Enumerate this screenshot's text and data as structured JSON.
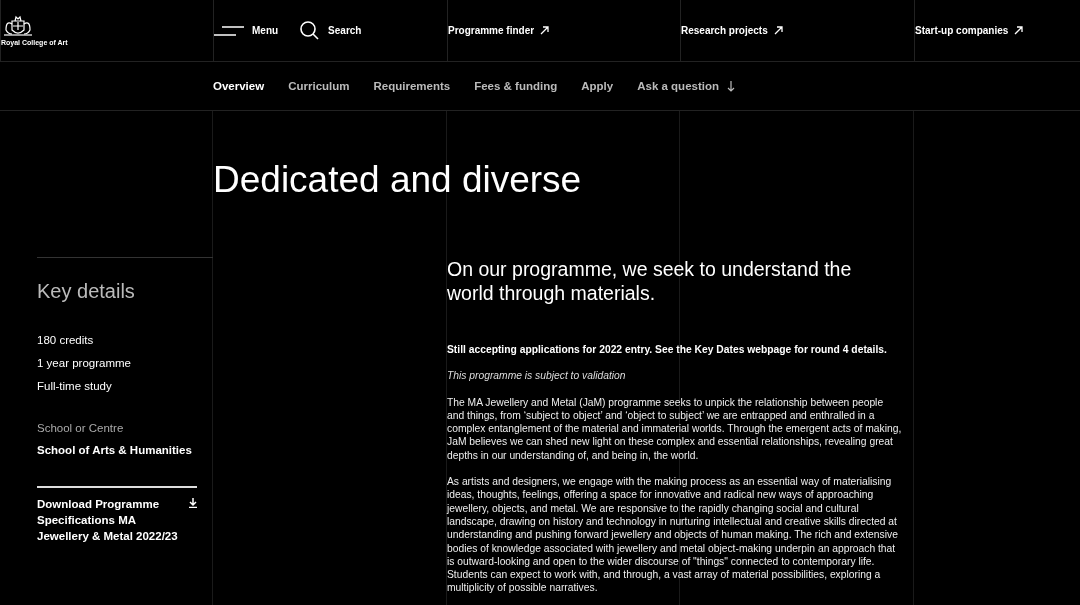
{
  "header": {
    "logo_text": "Royal College of Art",
    "menu_label": "Menu",
    "search_label": "Search",
    "links": [
      {
        "label": "Programme finder",
        "kind": "external"
      },
      {
        "label": "Research projects",
        "kind": "external"
      },
      {
        "label": "Start-up companies",
        "kind": "external"
      }
    ]
  },
  "subnav": {
    "tabs": [
      {
        "label": "Overview",
        "selected": true,
        "kind": "section"
      },
      {
        "label": "Curriculum",
        "selected": false,
        "kind": "section"
      },
      {
        "label": "Requirements",
        "selected": false,
        "kind": "section"
      },
      {
        "label": "Fees & funding",
        "selected": false,
        "kind": "section"
      },
      {
        "label": "Apply",
        "selected": false,
        "kind": "section"
      },
      {
        "label": "Ask a question",
        "selected": false,
        "kind": "jump"
      }
    ]
  },
  "page": {
    "title": "Dedicated and diverse",
    "intro": "On our programme, we seek to understand the world through materials."
  },
  "key_details": {
    "title": "Key details",
    "facts": [
      "180 credits",
      "1 year programme",
      "Full-time study"
    ],
    "school_label": "School or Centre",
    "school": "School of Arts & Humanities",
    "download": "Download Programme Specifications MA Jewellery & Metal 2022/23"
  },
  "content": {
    "paragraphs": [
      {
        "kind": "notice",
        "text": "Still accepting applications for 2022 entry. See the Key Dates webpage for round 4 details."
      },
      {
        "kind": "note",
        "text": "This programme is subject to validation"
      },
      {
        "kind": "body",
        "text": "The MA Jewellery and Metal (JaM) programme seeks to unpick the relationship between people and things, from ‘subject to object’ and ‘object to subject’ we are entrapped and enthralled in a complex entanglement of the material and immaterial worlds. Through the emergent acts of making, JaM believes we can shed new light on these complex and essential relationships, revealing great depths in our understanding of, and being in, the world."
      },
      {
        "kind": "body",
        "text": "As artists and designers, we engage with the making process as an essential way of materialising ideas, thoughts, feelings, offering a space for innovative and radical new ways of approaching jewellery, objects, and metal. We are responsive to the rapidly changing social and cultural landscape, drawing on history and technology in nurturing intellectual and creative skills directed at understanding and pushing forward jewellery and objects of human making. The rich and extensive bodies of knowledge associated with jewellery and metal object-making underpin an approach that is outward-looking and open to the wider discourse of \"things\" connected to contemporary life. Students can expect to work with, and through, a vast array of material possibilities, exploring a multiplicity of possible narratives."
      }
    ]
  }
}
